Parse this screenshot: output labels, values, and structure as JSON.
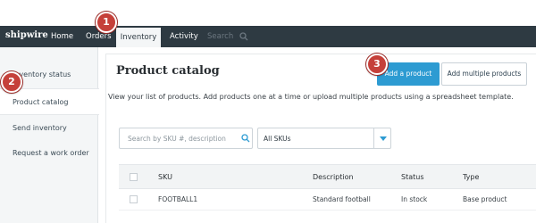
{
  "colors": {
    "nav_bg": "#2e3a42",
    "accent": "#2d9bd2",
    "callout": "#c5403a"
  },
  "topnav": {
    "brand": "shipwire",
    "items": [
      {
        "label": "Home"
      },
      {
        "label": "Orders"
      },
      {
        "label": "Inventory",
        "active": true
      },
      {
        "label": "Activity"
      }
    ],
    "search_label": "Search",
    "search_icon": "search-icon"
  },
  "sidebar": {
    "items": [
      {
        "label": "Inventory status"
      },
      {
        "label": "Product catalog",
        "active": true
      },
      {
        "label": "Send inventory"
      },
      {
        "label": "Request a work order"
      }
    ]
  },
  "main": {
    "title": "Product catalog",
    "subtitle": "View your list of products. Add products one at a time or upload multiple products using a spreadsheet template.",
    "add_product": "Add a product",
    "add_multiple": "Add multiple products",
    "search_placeholder": "Search by SKU #, description",
    "filter_value": "All SKUs"
  },
  "table": {
    "headers": [
      "SKU",
      "Description",
      "Status",
      "Type"
    ],
    "rows": [
      {
        "sku": "FOOTBALL1",
        "description": "Standard football",
        "status": "In stock",
        "type": "Base product"
      }
    ]
  },
  "callouts": [
    "1",
    "2",
    "3"
  ]
}
